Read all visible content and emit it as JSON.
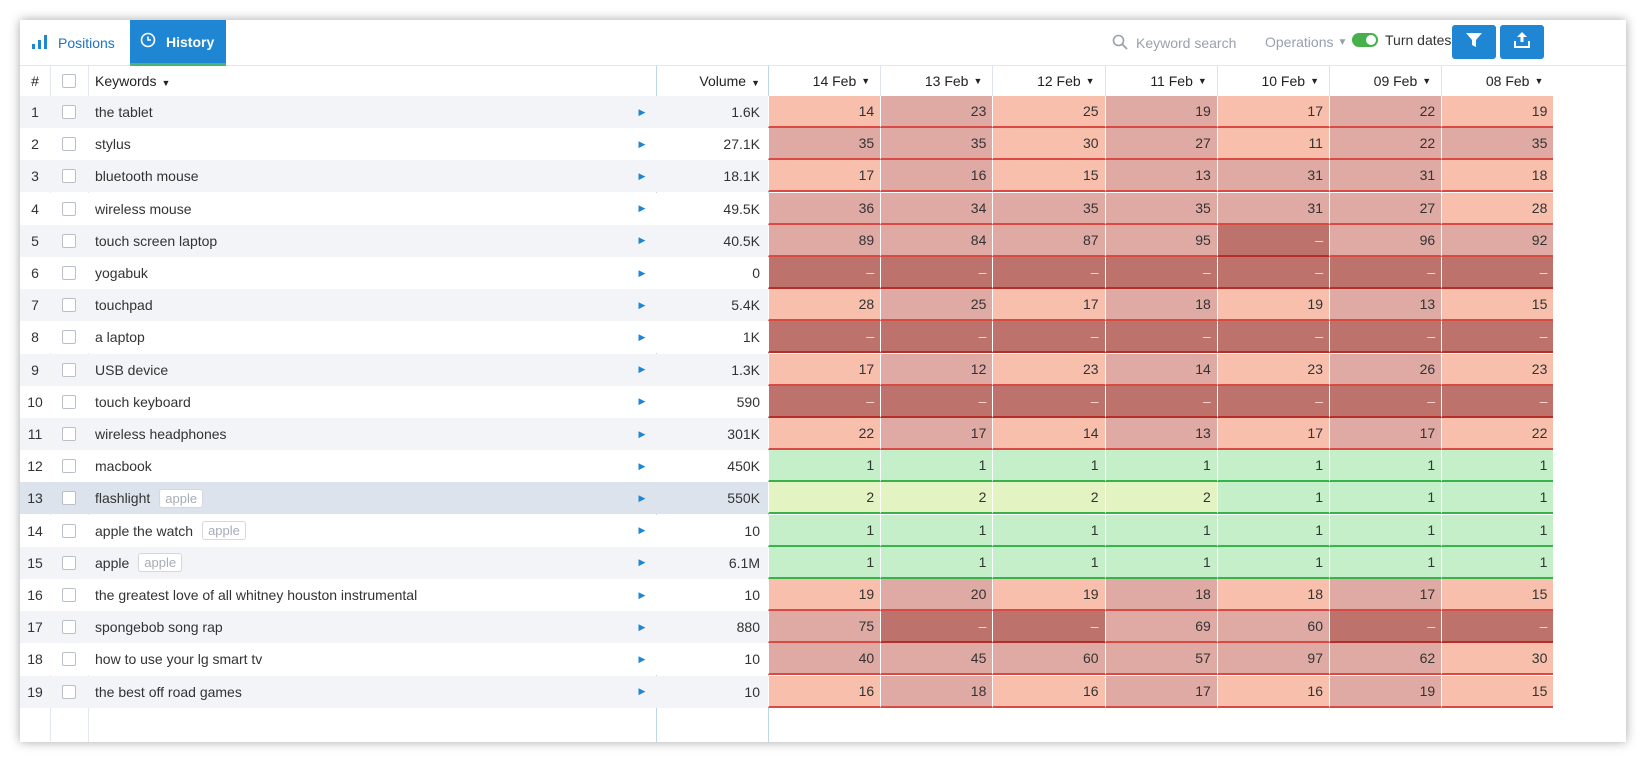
{
  "tabs": [
    {
      "label": "Positions",
      "icon": "bar-chart-icon",
      "active": false
    },
    {
      "label": "History",
      "icon": "clock-icon",
      "active": true
    }
  ],
  "toolbar": {
    "search_placeholder": "Keyword search",
    "operations_label": "Operations",
    "turn_dates_label": "Turn dates",
    "turn_dates_on": true
  },
  "columns": {
    "num": "#",
    "keywords": "Keywords",
    "volume": "Volume",
    "dates": [
      "14 Feb",
      "13 Feb",
      "12 Feb",
      "11 Feb",
      "10 Feb",
      "09 Feb",
      "08 Feb"
    ]
  },
  "colors": {
    "accent": "#1f86d4",
    "toggle_on": "#46b04a",
    "pos_light_red": "#f7bfac",
    "pos_mid_red": "#e0aaa4",
    "pos_dark_red": "#bd736b",
    "pos_green": "#c4efc9",
    "pos_yellow_green": "#e4f3c2"
  },
  "rows": [
    {
      "num": "1",
      "keyword": "the tablet",
      "tag": "",
      "volume": "1.6K",
      "positions": [
        "14",
        "23",
        "25",
        "19",
        "17",
        "22",
        "19"
      ]
    },
    {
      "num": "2",
      "keyword": "stylus",
      "tag": "",
      "volume": "27.1K",
      "positions": [
        "35",
        "35",
        "30",
        "27",
        "11",
        "22",
        "35"
      ]
    },
    {
      "num": "3",
      "keyword": "bluetooth mouse",
      "tag": "",
      "volume": "18.1K",
      "positions": [
        "17",
        "16",
        "15",
        "13",
        "31",
        "31",
        "18"
      ]
    },
    {
      "num": "4",
      "keyword": "wireless mouse",
      "tag": "",
      "volume": "49.5K",
      "positions": [
        "36",
        "34",
        "35",
        "35",
        "31",
        "27",
        "28"
      ]
    },
    {
      "num": "5",
      "keyword": "touch screen laptop",
      "tag": "",
      "volume": "40.5K",
      "positions": [
        "89",
        "84",
        "87",
        "95",
        "–",
        "96",
        "92"
      ]
    },
    {
      "num": "6",
      "keyword": "yogabuk",
      "tag": "",
      "volume": "0",
      "positions": [
        "–",
        "–",
        "–",
        "–",
        "–",
        "–",
        "–"
      ]
    },
    {
      "num": "7",
      "keyword": "touchpad",
      "tag": "",
      "volume": "5.4K",
      "positions": [
        "28",
        "25",
        "17",
        "18",
        "19",
        "13",
        "15"
      ]
    },
    {
      "num": "8",
      "keyword": "a laptop",
      "tag": "",
      "volume": "1K",
      "positions": [
        "–",
        "–",
        "–",
        "–",
        "–",
        "–",
        "–"
      ]
    },
    {
      "num": "9",
      "keyword": "USB device",
      "tag": "",
      "volume": "1.3K",
      "positions": [
        "17",
        "12",
        "23",
        "14",
        "23",
        "26",
        "23"
      ]
    },
    {
      "num": "10",
      "keyword": "touch keyboard",
      "tag": "",
      "volume": "590",
      "positions": [
        "–",
        "–",
        "–",
        "–",
        "–",
        "–",
        "–"
      ]
    },
    {
      "num": "11",
      "keyword": "wireless headphones",
      "tag": "",
      "volume": "301K",
      "positions": [
        "22",
        "17",
        "14",
        "13",
        "17",
        "17",
        "22"
      ]
    },
    {
      "num": "12",
      "keyword": "macbook",
      "tag": "",
      "volume": "450K",
      "positions": [
        "1",
        "1",
        "1",
        "1",
        "1",
        "1",
        "1"
      ]
    },
    {
      "num": "13",
      "keyword": "flashlight",
      "tag": "apple",
      "volume": "550K",
      "positions": [
        "2",
        "2",
        "2",
        "2",
        "1",
        "1",
        "1"
      ]
    },
    {
      "num": "14",
      "keyword": "apple the watch",
      "tag": "apple",
      "volume": "10",
      "positions": [
        "1",
        "1",
        "1",
        "1",
        "1",
        "1",
        "1"
      ]
    },
    {
      "num": "15",
      "keyword": "apple",
      "tag": "apple",
      "volume": "6.1M",
      "positions": [
        "1",
        "1",
        "1",
        "1",
        "1",
        "1",
        "1"
      ]
    },
    {
      "num": "16",
      "keyword": "the greatest love of all whitney houston instrumental",
      "tag": "",
      "volume": "10",
      "positions": [
        "19",
        "20",
        "19",
        "18",
        "18",
        "17",
        "15"
      ]
    },
    {
      "num": "17",
      "keyword": "spongebob song rap",
      "tag": "",
      "volume": "880",
      "positions": [
        "75",
        "–",
        "–",
        "69",
        "60",
        "–",
        "–"
      ]
    },
    {
      "num": "18",
      "keyword": "how to use your lg smart tv",
      "tag": "",
      "volume": "10",
      "positions": [
        "40",
        "45",
        "60",
        "57",
        "97",
        "62",
        "30"
      ]
    },
    {
      "num": "19",
      "keyword": "the best off road games",
      "tag": "",
      "volume": "10",
      "positions": [
        "16",
        "18",
        "16",
        "17",
        "16",
        "19",
        "15"
      ]
    }
  ],
  "selected_row": "13"
}
